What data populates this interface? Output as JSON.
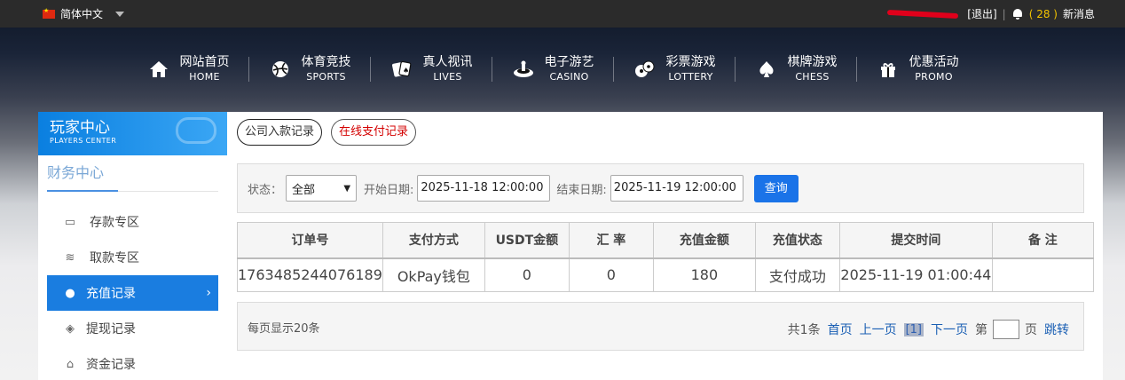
{
  "topbar": {
    "language": "简体中文",
    "logout": "[退出]",
    "divider": "|",
    "msg_count": "( 28 )",
    "msg_label": "新消息"
  },
  "nav": [
    {
      "cn": "网站首页",
      "en": "HOME",
      "icon": "home-icon"
    },
    {
      "cn": "体育竞技",
      "en": "SPORTS",
      "icon": "ball-icon"
    },
    {
      "cn": "真人视讯",
      "en": "LIVES",
      "icon": "cards-icon"
    },
    {
      "cn": "电子游艺",
      "en": "CASINO",
      "icon": "slot-icon"
    },
    {
      "cn": "彩票游戏",
      "en": "LOTTERY",
      "icon": "lottery-balls-icon"
    },
    {
      "cn": "棋牌游戏",
      "en": "CHESS",
      "icon": "spade-icon"
    },
    {
      "cn": "优惠活动",
      "en": "PROMO",
      "icon": "gift-icon"
    }
  ],
  "sidebar": {
    "title_cn": "玩家中心",
    "title_en": "PLAYERS CENTER",
    "section": "财务中心",
    "items": [
      {
        "label": "存款专区",
        "icon": "card-icon"
      },
      {
        "label": "取款专区",
        "icon": "cash-icon"
      },
      {
        "label": "充值记录",
        "icon": "money-bag-icon",
        "active": true
      },
      {
        "label": "提现记录",
        "icon": "hand-coin-icon"
      },
      {
        "label": "资金记录",
        "icon": "bank-icon"
      }
    ]
  },
  "tabs": {
    "company": "公司入款记录",
    "online": "在线支付记录"
  },
  "filter": {
    "status_label": "状态：",
    "status_value": "全部",
    "start_label": "开始日期:",
    "start_value": "2025-11-18 12:00:00",
    "end_label": "结束日期:",
    "end_value": "2025-11-19 12:00:00",
    "query_label": "查询"
  },
  "table": {
    "headers": [
      "订单号",
      "支付方式",
      "USDT金额",
      "汇 率",
      "充值金额",
      "充值状态",
      "提交时间",
      "备 注"
    ],
    "rows": [
      [
        "1763485244076189",
        "OkPay钱包",
        "0",
        "0",
        "180",
        "支付成功",
        "2025-11-19 01:00:44",
        ""
      ]
    ]
  },
  "pager": {
    "per_page": "每页显示20条",
    "total": "共1条",
    "first": "首页",
    "prev": "上一页",
    "current": "[1]",
    "next": "下一页",
    "page_prefix": "第",
    "page_suffix": "页",
    "jump": "跳转"
  },
  "colors": {
    "accent_blue": "#1a7de0",
    "button_blue": "#1a73e8",
    "tab_red": "#d40000",
    "msg_yellow": "#f2c200"
  }
}
